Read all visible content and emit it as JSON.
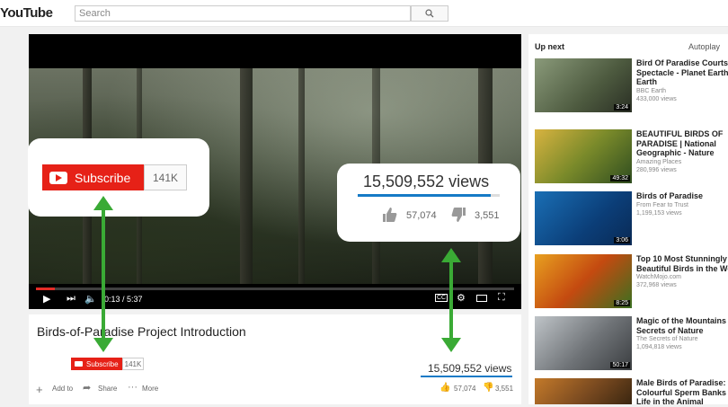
{
  "header": {
    "logo": "YouTube",
    "search_placeholder": "Search"
  },
  "player": {
    "time_current": "0:13",
    "time_total": "5:37",
    "time_display": "0:13 / 5:37",
    "progress_fraction": 0.04
  },
  "callout_subscribe": {
    "label": "Subscribe",
    "count": "141K"
  },
  "callout_views": {
    "views": "15,509,552 views",
    "likes": "57,074",
    "dislikes": "3,551"
  },
  "video": {
    "title": "Birds-of-Paradise Project Introduction",
    "subscribe_label": "Subscribe",
    "subscriber_count": "141K",
    "views": "15,509,552 views",
    "likes": "57,074",
    "dislikes": "3,551",
    "add_to": "Add to",
    "share": "Share",
    "more": "More"
  },
  "sidebar": {
    "up_next": "Up next",
    "autoplay": "Autoplay",
    "items": [
      {
        "title_lines": [
          "Bird Of Paradise Courtship",
          "Spectacle - Planet Earth -",
          "Earth"
        ],
        "channel": "BBC Earth",
        "views": "433,000 views",
        "duration": "3:24"
      },
      {
        "title_lines": [
          "BEAUTIFUL BIRDS OF",
          "PARADISE | National",
          "Geographic - Nature"
        ],
        "channel": "Amazing Places",
        "views": "280,996 views",
        "duration": "49:32"
      },
      {
        "title_lines": [
          "Birds of Paradise"
        ],
        "channel": "From Fear to Trust",
        "views": "1,199,153 views",
        "duration": "3:06"
      },
      {
        "title_lines": [
          "Top 10 Most Stunningly",
          "Beautiful Birds in the World"
        ],
        "channel": "WatchMojo.com",
        "views": "372,968 views",
        "duration": "8:25"
      },
      {
        "title_lines": [
          "Magic of the Mountains -",
          "Secrets of Nature"
        ],
        "channel": "The Secrets of Nature",
        "views": "1,094,818 views",
        "duration": "50:17"
      },
      {
        "title_lines": [
          "Male Birds of Paradise:",
          "Colourful Sperm Banks -",
          "Life in the Animal"
        ],
        "channel": "",
        "views": "",
        "duration": ""
      }
    ]
  },
  "colors": {
    "youtube_red": "#e62117",
    "arrow_green": "#3aaa35",
    "link_blue": "#167ac6"
  }
}
